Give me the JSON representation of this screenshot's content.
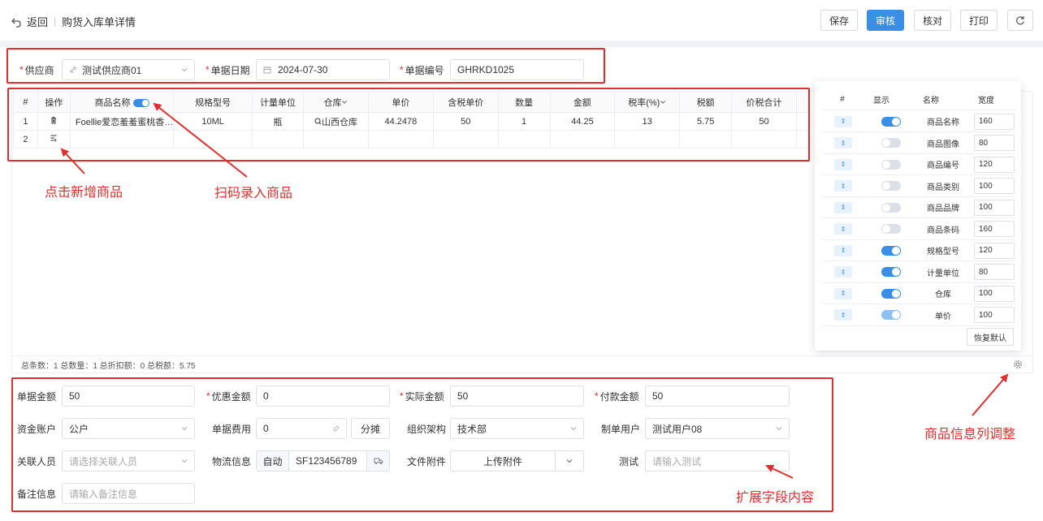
{
  "header": {
    "back_label": "返回",
    "page_title": "购货入库单详情",
    "buttons": {
      "save": "保存",
      "audit": "审核",
      "check": "核对",
      "print": "打印"
    }
  },
  "top_form": {
    "supplier_label": "供应商",
    "supplier_value": "测试供应商01",
    "date_label": "单据日期",
    "date_value": "2024-07-30",
    "number_label": "单据编号",
    "number_value": "GHRKD1025"
  },
  "table": {
    "headers": [
      "#",
      "操作",
      "商品名称",
      "规格型号",
      "计量单位",
      "仓库",
      "单价",
      "含税单价",
      "数量",
      "金额",
      "税率(%)",
      "税额",
      "价税合计"
    ],
    "row1": {
      "index": "1",
      "name": "Foellie爱恋羞羞蜜桃香…",
      "spec": "10ML",
      "unit": "瓶",
      "warehouse": "山西仓库",
      "price": "44.2478",
      "tax_price": "50",
      "qty": "1",
      "amount": "44.25",
      "tax_rate": "13",
      "tax": "5.75",
      "total": "50"
    },
    "row2_index": "2",
    "summary": "总条数：1   总数量：1   总折扣额：0   总税额：5.75"
  },
  "column_panel": {
    "headers": [
      "#",
      "显示",
      "名称",
      "宽度"
    ],
    "rows": [
      {
        "name": "商品名称",
        "width": "160",
        "state": "on"
      },
      {
        "name": "商品图像",
        "width": "80",
        "state": "off"
      },
      {
        "name": "商品编号",
        "width": "120",
        "state": "off"
      },
      {
        "name": "商品类别",
        "width": "100",
        "state": "off"
      },
      {
        "name": "商品品牌",
        "width": "100",
        "state": "off"
      },
      {
        "name": "商品条码",
        "width": "160",
        "state": "off"
      },
      {
        "name": "规格型号",
        "width": "120",
        "state": "on"
      },
      {
        "name": "计量单位",
        "width": "80",
        "state": "on"
      },
      {
        "name": "仓库",
        "width": "100",
        "state": "on"
      },
      {
        "name": "单价",
        "width": "100",
        "state": "half"
      }
    ],
    "reset_label": "恢复默认"
  },
  "bottom_form": {
    "bill_amount_label": "单据金额",
    "bill_amount": "50",
    "discount_label": "优惠金额",
    "discount": "0",
    "actual_label": "实际金额",
    "actual": "50",
    "pay_label": "付款金额",
    "pay": "50",
    "account_label": "资金账户",
    "account": "公户",
    "fee_label": "单据费用",
    "fee": "0",
    "split_label": "分摊",
    "org_label": "组织架构",
    "org": "技术部",
    "maker_label": "制单用户",
    "maker": "测试用户08",
    "related_label": "关联人员",
    "related_ph": "请选择关联人员",
    "logistics_label": "物流信息",
    "logistics_mode": "自动",
    "logistics_no": "SF123456789",
    "file_label": "文件附件",
    "upload_label": "上传附件",
    "test_label": "测试",
    "test_ph": "请输入测试",
    "remark_label": "备注信息",
    "remark_ph": "请输入备注信息"
  },
  "annotations": {
    "add_goods": "点击新增商品",
    "scan_goods": "扫码录入商品",
    "column_adjust": "商品信息列调整",
    "extend_fields": "扩展字段内容"
  },
  "colors": {
    "accent": "#3a8ee6",
    "annotation": "#e02f2f"
  }
}
